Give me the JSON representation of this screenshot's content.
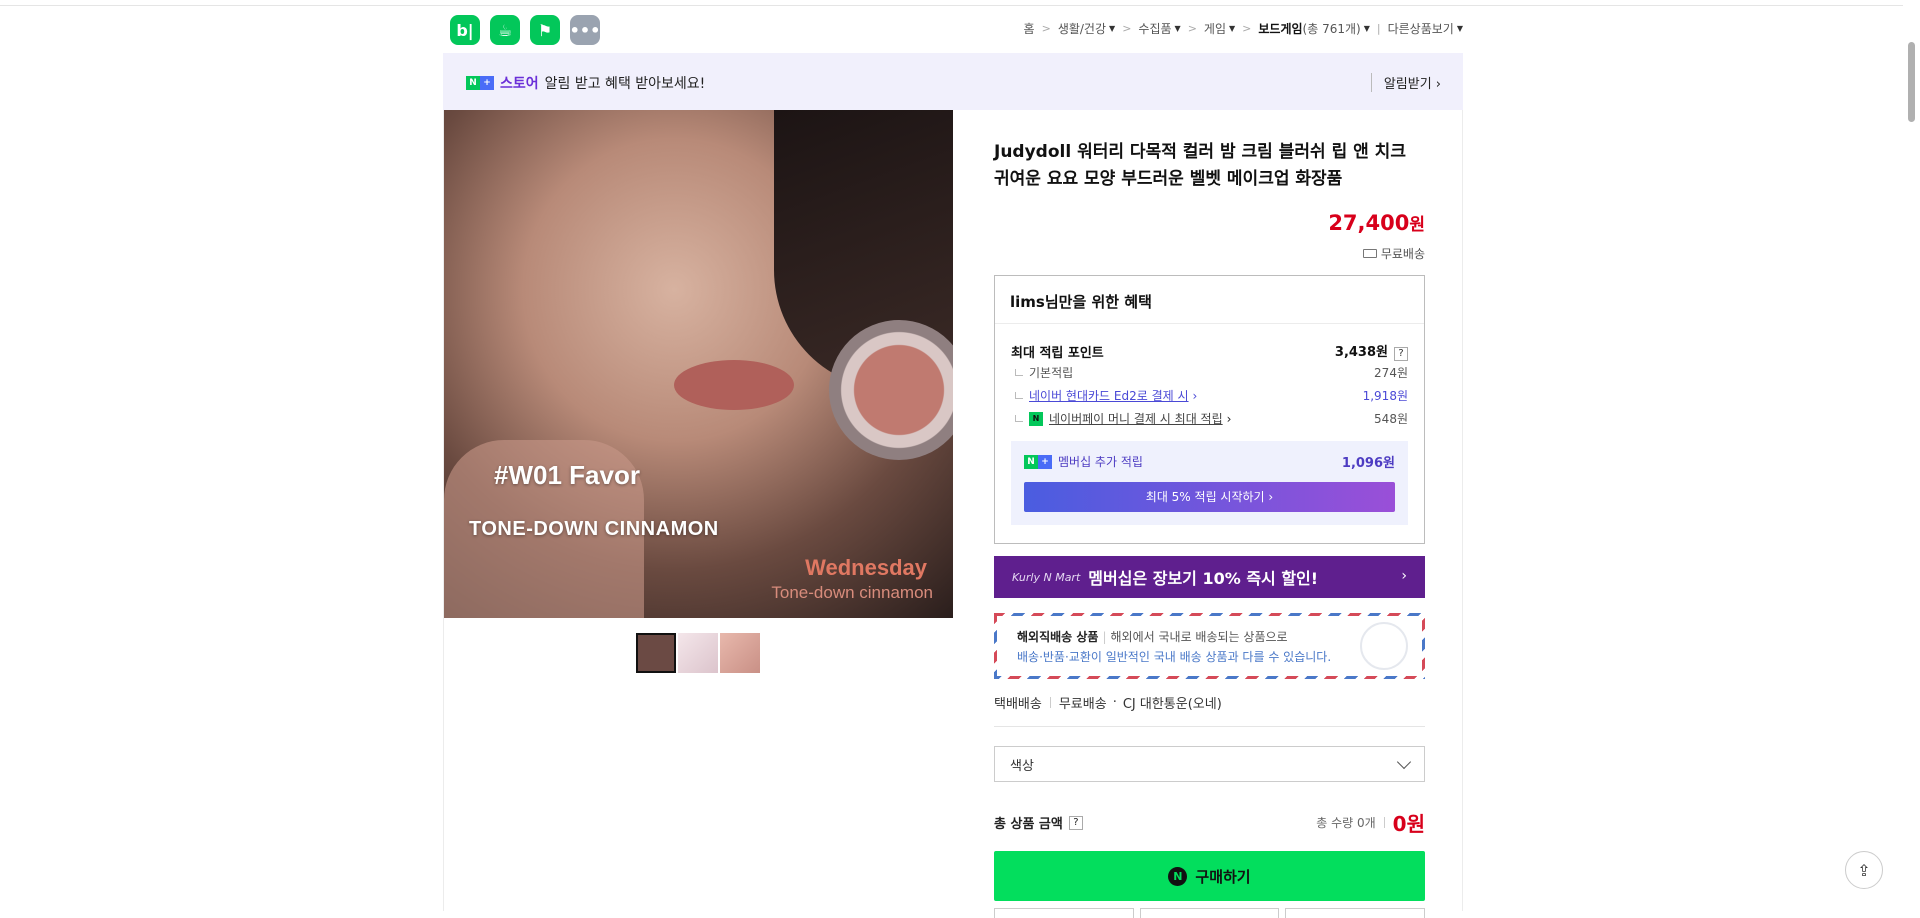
{
  "app_icons": [
    {
      "label": "b|",
      "name": "blog"
    },
    {
      "label": "☕",
      "name": "cafe"
    },
    {
      "label": "⚑",
      "name": "bookmark"
    },
    {
      "label": "•••",
      "name": "more"
    }
  ],
  "breadcrumb": {
    "home": "홈",
    "items": [
      "생활/건강",
      "수집품",
      "게임"
    ],
    "current": "보드게임",
    "count": "(총 761개)",
    "other": "다른상품보기"
  },
  "banner": {
    "store": "스토어",
    "message": "알림 받고 혜택 받아보세요!",
    "subscribe": "알림받기 ›"
  },
  "photo": {
    "line1": "#W01 Favor",
    "line2": "TONE-DOWN CINNAMON",
    "line3": "Wednesday",
    "line4": "Tone-down cinnamon"
  },
  "product": {
    "title": "Judydoll 워터리 다목적 컬러 밤 크림 블러쉬 립 앤 치크 귀여운 요요 모양 부드러운 벨벳 메이크업 화장품",
    "price": "27,400",
    "price_unit": "원",
    "shipping": "무료배송"
  },
  "benefit": {
    "header": "lims님만을 위한 혜택",
    "max_points_label": "최대 적립 포인트",
    "max_points_value": "3,438원",
    "help": "?",
    "rows": [
      {
        "label": "기본적립",
        "value": "274원"
      },
      {
        "label": "네이버 현대카드 Ed2로 결제 시",
        "value": "1,918원"
      },
      {
        "label": "네이버페이 머니 결제 시 최대 적립",
        "value": "548원"
      }
    ],
    "membership_label": "멤버십 추가 적립",
    "membership_value": "1,096원",
    "cta": "최대 5% 적립 시작하기 ›"
  },
  "kurly": {
    "brand": "Kurly N Mart",
    "text": "멤버십은 장보기 10% 즉시 할인!"
  },
  "overseas": {
    "title": "해외직배송 상품",
    "desc": "해외에서 국내로 배송되는 상품으로",
    "note": "배송·반품·교환이 일반적인 국내 배송 상품과 다를 수 있습니다."
  },
  "delivery": {
    "type": "택배배송",
    "fee": "무료배송",
    "carrier": "CJ 대한통운(오네)"
  },
  "option": {
    "placeholder": "색상"
  },
  "total": {
    "label": "총 상품 금액",
    "help": "?",
    "quantity": "총 수량 0개",
    "amount": "0원"
  },
  "buy": {
    "label": "구매하기",
    "icon": "N"
  }
}
